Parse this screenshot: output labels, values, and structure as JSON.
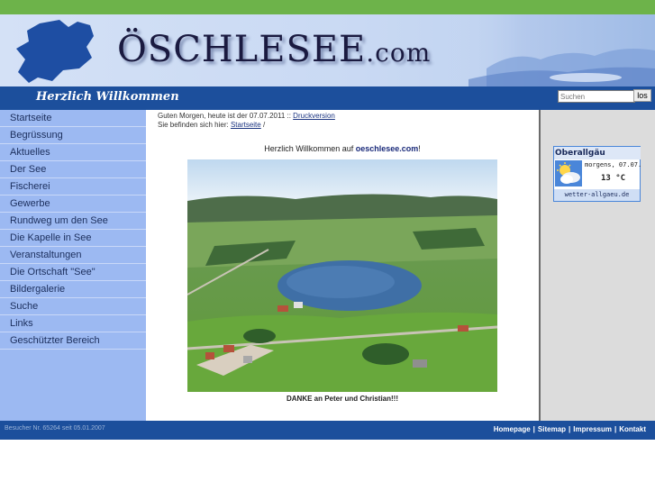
{
  "header": {
    "title_main": "ÖSCHLESEE",
    "title_suffix": ".com"
  },
  "navbar": {
    "welcome": "Herzlich Willkommen",
    "search_placeholder": "Suchen",
    "search_button": "los"
  },
  "sidebar": {
    "items": [
      {
        "label": "Startseite"
      },
      {
        "label": "Begrüssung"
      },
      {
        "label": "Aktuelles"
      },
      {
        "label": "Der See"
      },
      {
        "label": "Fischerei"
      },
      {
        "label": "Gewerbe"
      },
      {
        "label": "Rundweg um den See"
      },
      {
        "label": "Die Kapelle in See"
      },
      {
        "label": "Veranstaltungen"
      },
      {
        "label": "Die Ortschaft \"See\""
      },
      {
        "label": "Bildergalerie"
      },
      {
        "label": "Suche"
      },
      {
        "label": "Links"
      },
      {
        "label": "Geschützter Bereich"
      }
    ]
  },
  "main": {
    "greeting_prefix": "Guten Morgen, heute ist der 07.07.2011 :: ",
    "print_link": "Druckversion",
    "location_prefix": "Sie befinden sich hier: ",
    "breadcrumb_link": "Startseite",
    "breadcrumb_suffix": " /",
    "intro_text": "Herzlich Willkommen auf ",
    "intro_bold": "oeschlesee.com",
    "intro_suffix": "!",
    "caption": "DANKE an Peter und Christian!!!"
  },
  "weather": {
    "region": "Oberallgäu",
    "date": "morgens, 07.07.",
    "temperature": "13 °C",
    "source": "wetter-allgaeu.de",
    "icon": "cloudy-sun-icon"
  },
  "footer": {
    "visitors": "Besucher Nr. 65264 seit 05.01.2007",
    "links": [
      "Homepage",
      "Sitemap",
      "Impressum",
      "Kontakt"
    ]
  },
  "colors": {
    "top_bar": "#6db34a",
    "nav_blue": "#1c4f9c",
    "sidebar_blue": "#9cb9f2",
    "header_bg": "#c9d9f3"
  }
}
